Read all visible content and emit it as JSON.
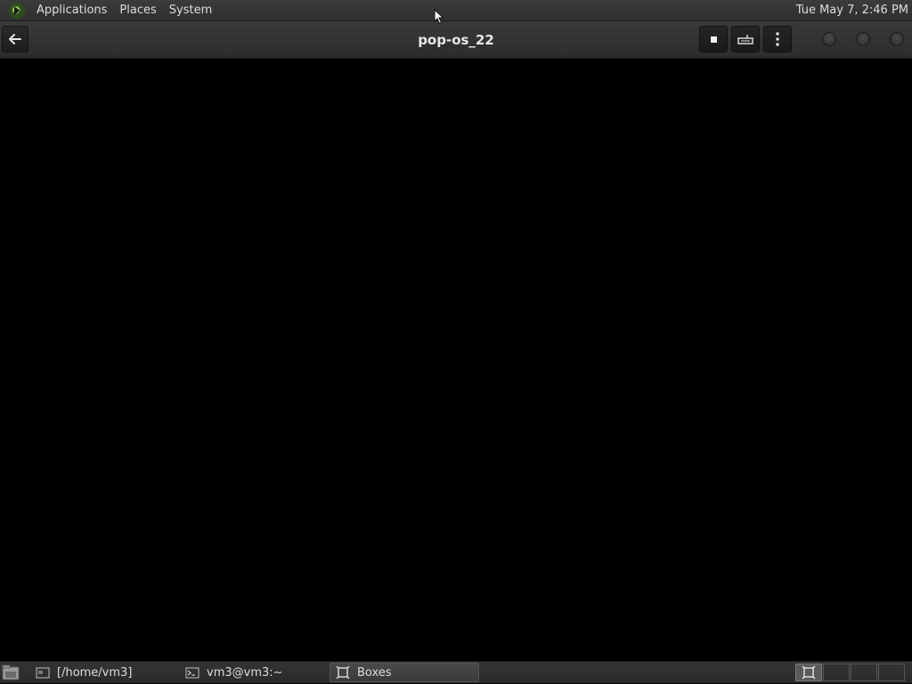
{
  "top_panel": {
    "menus": [
      "Applications",
      "Places",
      "System"
    ],
    "clock": "Tue May 7,  2:46 PM"
  },
  "header": {
    "title": "pop-os_22",
    "back_icon": "back-arrow-icon",
    "buttons": [
      "stop-icon",
      "keyboard-icon",
      "menu-kebab-icon"
    ]
  },
  "taskbar": {
    "tasks": [
      {
        "label": "[/home/vm3]",
        "icon": "file-manager-icon"
      },
      {
        "label": "vm3@vm3:~",
        "icon": "terminal-icon"
      },
      {
        "label": "Boxes",
        "icon": "boxes-icon",
        "active": true
      }
    ]
  }
}
